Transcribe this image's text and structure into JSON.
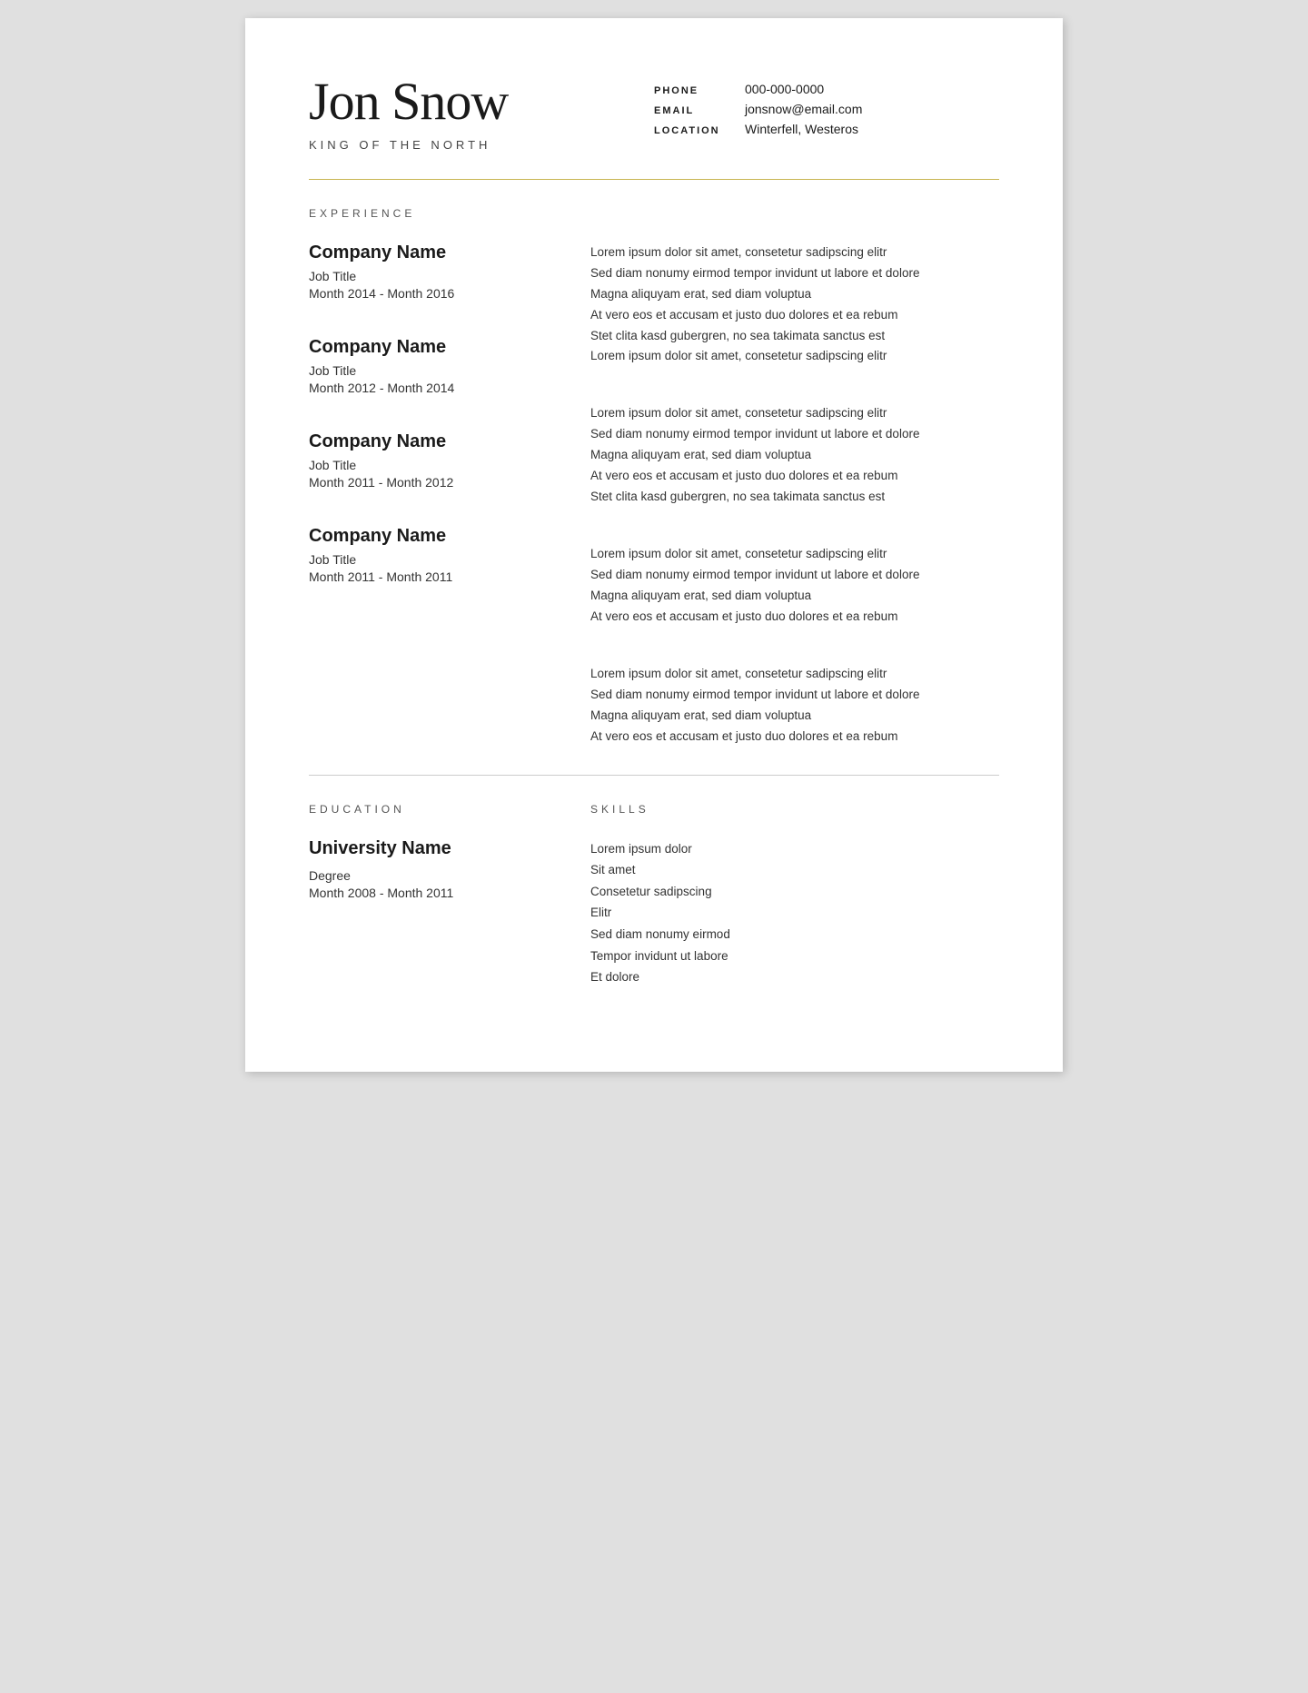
{
  "header": {
    "name": "Jon Snow",
    "tagline": "KING OF THE NORTH",
    "contact": [
      {
        "label": "PHONE",
        "value": "000-000-0000"
      },
      {
        "label": "EMAIL",
        "value": "jonsnow@email.com"
      },
      {
        "label": "LOCATION",
        "value": "Winterfell, Westeros"
      }
    ]
  },
  "sections": {
    "experience_title": "EXPERIENCE",
    "education_title": "EDUCATION",
    "skills_title": "SKILLS"
  },
  "experience": [
    {
      "company": "Company Name",
      "title": "Job Title",
      "dates": "Month 2014 - Month 2016",
      "description": [
        "Lorem ipsum dolor sit amet, consetetur sadipscing elitr",
        "Sed diam nonumy eirmod tempor invidunt ut labore et dolore",
        "Magna aliquyam erat, sed diam voluptua",
        "At vero eos et accusam et justo duo dolores et ea rebum",
        "Stet clita kasd gubergren, no sea takimata sanctus est",
        "Lorem ipsum dolor sit amet, consetetur sadipscing elitr"
      ]
    },
    {
      "company": "Company Name",
      "title": "Job Title",
      "dates": "Month 2012 - Month 2014",
      "description": [
        "Lorem ipsum dolor sit amet, consetetur sadipscing elitr",
        "Sed diam nonumy eirmod tempor invidunt ut labore et dolore",
        "Magna aliquyam erat, sed diam voluptua",
        "At vero eos et accusam et justo duo dolores et ea rebum",
        "Stet clita kasd gubergren, no sea takimata sanctus est"
      ]
    },
    {
      "company": "Company Name",
      "title": "Job Title",
      "dates": "Month 2011 - Month 2012",
      "description": [
        "Lorem ipsum dolor sit amet, consetetur sadipscing elitr",
        "Sed diam nonumy eirmod tempor invidunt ut labore et dolore",
        "Magna aliquyam erat, sed diam voluptua",
        "At vero eos et accusam et justo duo dolores et ea rebum"
      ]
    },
    {
      "company": "Company Name",
      "title": "Job Title",
      "dates": "Month 2011 - Month 2011",
      "description": [
        "Lorem ipsum dolor sit amet, consetetur sadipscing elitr",
        "Sed diam nonumy eirmod tempor invidunt ut labore et dolore",
        "Magna aliquyam erat, sed diam voluptua",
        "At vero eos et accusam et justo duo dolores et ea rebum"
      ]
    }
  ],
  "education": [
    {
      "university": "University Name",
      "degree": "Degree",
      "dates": "Month 2008 - Month 2011"
    }
  ],
  "skills": [
    "Lorem ipsum dolor",
    "Sit amet",
    "Consetetur sadipscing",
    "Elitr",
    "Sed diam nonumy eirmod",
    "Tempor invidunt ut labore",
    "Et dolore"
  ]
}
